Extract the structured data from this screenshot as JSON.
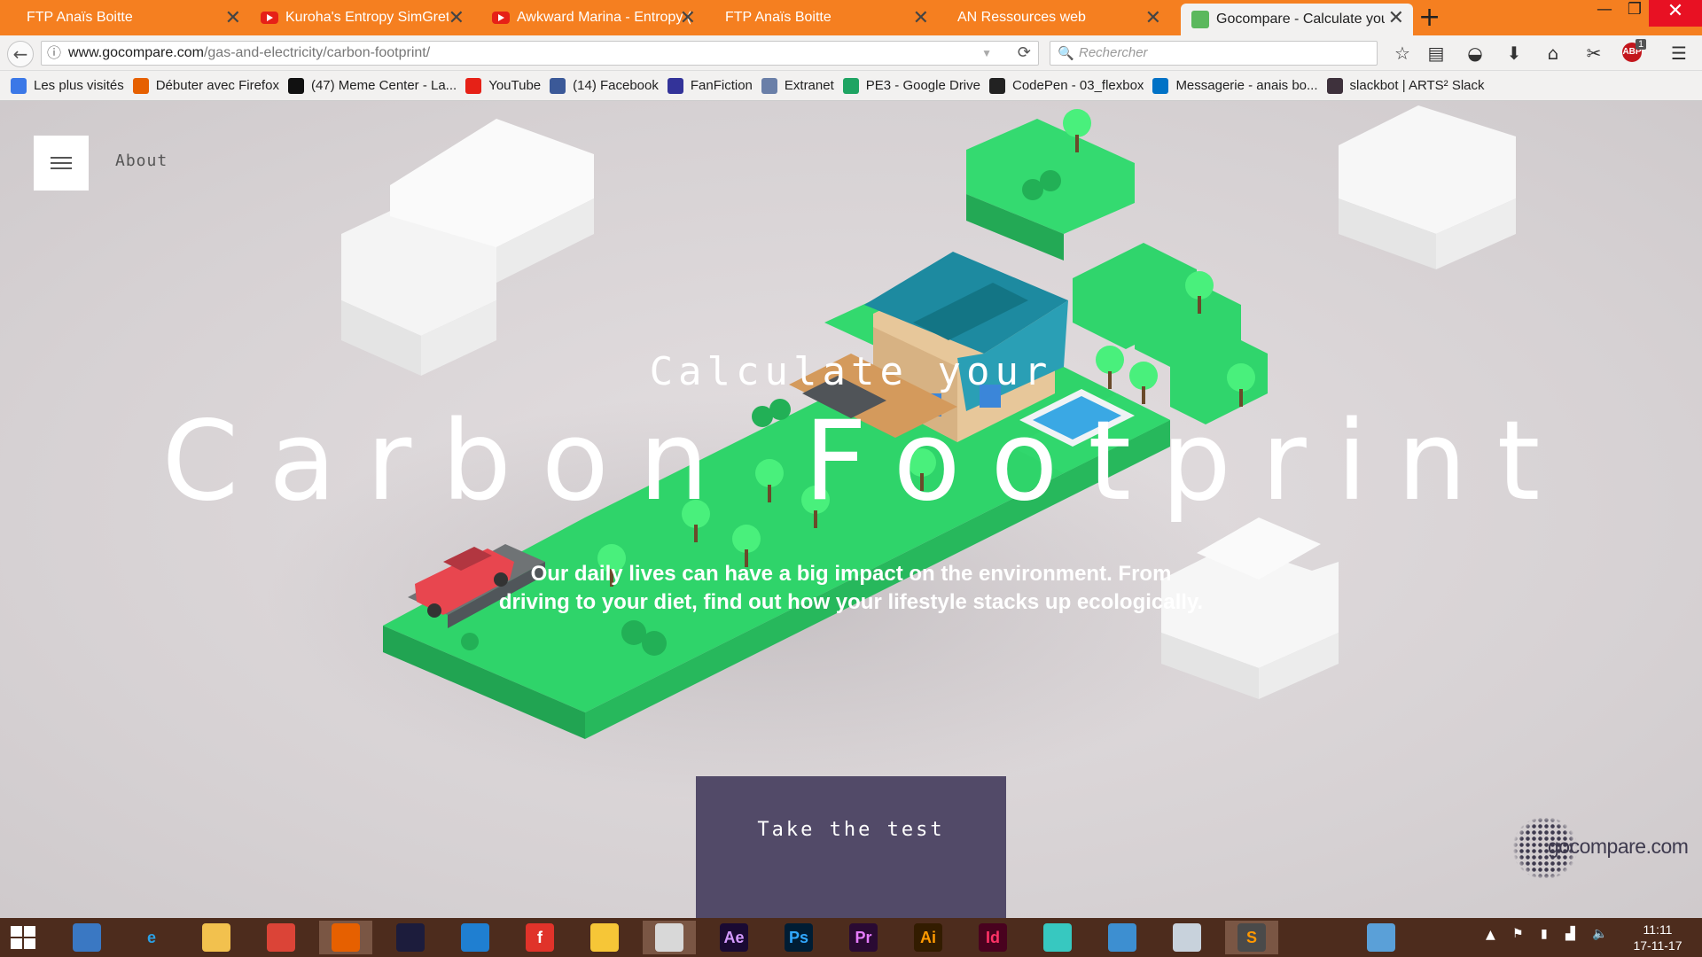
{
  "browser": {
    "tabs": [
      {
        "title": "FTP Anaïs Boitte",
        "favicon": "none",
        "active": false
      },
      {
        "title": "Kuroha's Entropy SimGretina",
        "favicon": "youtube-icon",
        "active": false
      },
      {
        "title": "Awkward Marina - Entropy (",
        "favicon": "youtube-icon",
        "active": false
      },
      {
        "title": "FTP Anaïs Boitte",
        "favicon": "none",
        "active": false
      },
      {
        "title": "AN Ressources web",
        "favicon": "none",
        "active": false
      },
      {
        "title": "Gocompare - Calculate your",
        "favicon": "gocompare-icon",
        "active": true
      }
    ],
    "url_host": "www.gocompare.com",
    "url_path": "/gas-and-electricity/carbon-footprint/",
    "search_placeholder": "Rechercher",
    "adblock_count": "1",
    "adblock_label": "ABP"
  },
  "bookmarks": [
    {
      "label": "Les plus visités",
      "icon": "most-visited-icon",
      "color": "#3b78e7"
    },
    {
      "label": "Débuter avec Firefox",
      "icon": "firefox-icon",
      "color": "#e66000"
    },
    {
      "label": "(47) Meme Center - La...",
      "icon": "memecenter-icon",
      "color": "#111111"
    },
    {
      "label": "YouTube",
      "icon": "youtube-icon",
      "color": "#e62117"
    },
    {
      "label": "(14) Facebook",
      "icon": "facebook-icon",
      "color": "#3b5998"
    },
    {
      "label": "FanFiction",
      "icon": "fanfiction-icon",
      "color": "#333399"
    },
    {
      "label": "Extranet",
      "icon": "extranet-icon",
      "color": "#6a7fa8"
    },
    {
      "label": "PE3 - Google Drive",
      "icon": "google-drive-icon",
      "color": "#1fa463"
    },
    {
      "label": "CodePen - 03_flexbox",
      "icon": "codepen-icon",
      "color": "#222222"
    },
    {
      "label": "Messagerie - anais bo...",
      "icon": "outlook-icon",
      "color": "#0072c6"
    },
    {
      "label": "slackbot | ARTS² Slack",
      "icon": "slack-icon",
      "color": "#3e313c"
    }
  ],
  "page": {
    "nav_about": "About",
    "hero_subtitle": "Calculate your",
    "hero_title": "Carbon Footprint",
    "hero_description": "Our daily lives can have a big impact on the environment. From driving to your diet, find out how your lifestyle stacks up ecologically.",
    "cta_label": "Take the test",
    "logo_text": "gocompare.com",
    "colors": {
      "background": "#d9d4d6",
      "grass": "#2ecc63",
      "cta": "#524a68",
      "browser_accent": "#f57f20"
    }
  },
  "taskbar": {
    "apps": [
      {
        "name": "task-view-icon",
        "label": "",
        "bg": "#3a78c3",
        "fg": "#ffffff"
      },
      {
        "name": "internet-explorer-icon",
        "label": "e",
        "bg": "transparent",
        "fg": "#2aa1e6"
      },
      {
        "name": "file-explorer-icon",
        "label": "",
        "bg": "#f2c14e",
        "fg": "#ffffff"
      },
      {
        "name": "chrome-icon",
        "label": "",
        "bg": "#db4437",
        "fg": "#ffffff"
      },
      {
        "name": "firefox-icon",
        "label": "",
        "bg": "#e66000",
        "fg": "#ffffff"
      },
      {
        "name": "audacity-icon",
        "label": "",
        "bg": "#1c1c3c",
        "fg": "#f5a623"
      },
      {
        "name": "thunderbird-icon",
        "label": "",
        "bg": "#1f7fd1",
        "fg": "#ffffff"
      },
      {
        "name": "flash-icon",
        "label": "f",
        "bg": "#e0332a",
        "fg": "#ffffff"
      },
      {
        "name": "cyberduck-icon",
        "label": "",
        "bg": "#f6c637",
        "fg": "#ffffff"
      },
      {
        "name": "paint-tool-icon",
        "label": "",
        "bg": "#d8d8d8",
        "fg": "#c0392b"
      },
      {
        "name": "after-effects-icon",
        "label": "Ae",
        "bg": "#1a0a33",
        "fg": "#d59bff"
      },
      {
        "name": "photoshop-icon",
        "label": "Ps",
        "bg": "#001d34",
        "fg": "#31a8ff"
      },
      {
        "name": "premiere-icon",
        "label": "Pr",
        "bg": "#2a0a33",
        "fg": "#e77cff"
      },
      {
        "name": "illustrator-icon",
        "label": "Ai",
        "bg": "#331c00",
        "fg": "#ff9a00"
      },
      {
        "name": "indesign-icon",
        "label": "Id",
        "bg": "#49021f",
        "fg": "#ff3366"
      },
      {
        "name": "miku-icon",
        "label": "",
        "bg": "#37c8c0",
        "fg": "#ffffff"
      },
      {
        "name": "character-app-icon",
        "label": "",
        "bg": "#3d8fd1",
        "fg": "#ffffff"
      },
      {
        "name": "system-monitor-icon",
        "label": "",
        "bg": "#c8d2dc",
        "fg": "#555555"
      },
      {
        "name": "sublime-text-icon",
        "label": "S",
        "bg": "#4a4a4a",
        "fg": "#ff9800"
      },
      {
        "name": "blender-icon",
        "label": "",
        "bg": "transparent",
        "fg": "#f5792a"
      },
      {
        "name": "control-panel-icon",
        "label": "",
        "bg": "#5aa0d8",
        "fg": "#ffffff"
      }
    ],
    "time": "11:11",
    "date": "17-11-17"
  }
}
